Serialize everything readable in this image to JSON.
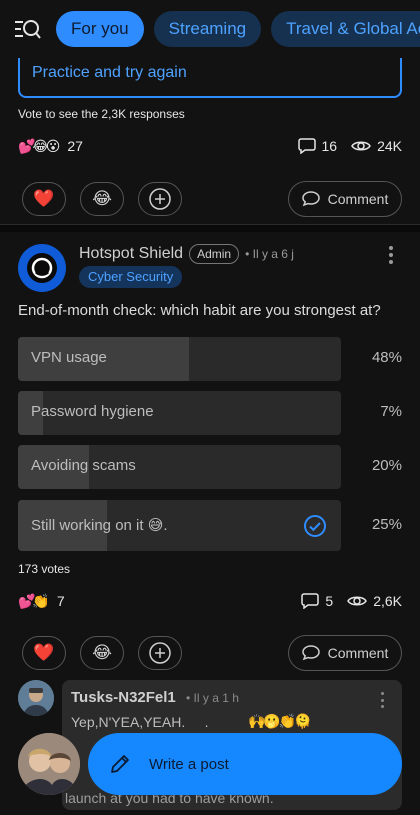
{
  "topbar": {
    "tabs": [
      {
        "label": "For you",
        "active": true
      },
      {
        "label": "Streaming",
        "active": false
      },
      {
        "label": "Travel & Global Acces",
        "active": false
      }
    ]
  },
  "prev_post": {
    "option_label": "Practice and try again",
    "vote_note": "Vote to see the 2,3K responses",
    "reaction_emojis": "💕😂😮",
    "reaction_count": "27",
    "comments": "16",
    "views": "24K",
    "comment_label": "Comment"
  },
  "post": {
    "author": "Hotspot Shield",
    "badge": "Admin",
    "time": "• Il y a 6 j",
    "tag": "Cyber Security",
    "question": "End-of-month check: which habit are you strongest at?",
    "poll": [
      {
        "label": "VPN usage",
        "percent_text": "48%",
        "fraction": 0.48,
        "selected": false
      },
      {
        "label": "Password hygiene",
        "percent_text": "7%",
        "fraction": 0.07,
        "selected": false
      },
      {
        "label": " Avoiding scams",
        "percent_text": "20%",
        "fraction": 0.2,
        "selected": false
      },
      {
        "label": "Still working on it 😅.",
        "percent_text": "25%",
        "fraction": 0.25,
        "selected": true
      }
    ],
    "votes": "173 votes",
    "reaction_emojis": "💕👏",
    "reaction_count": "7",
    "comments": "5",
    "views": "2,6K",
    "comment_label": "Comment"
  },
  "comment": {
    "author": "Tusks-N32Fel1",
    "time": "• Il y a 1 h",
    "text_line1": "Yep,N'YEA,YEAH.     .",
    "emojis": "🙌🫢👏🫠",
    "text_line2": "launch at you had to have known."
  },
  "fab": {
    "label": "Write a post"
  },
  "colors": {
    "accent": "#2f8cff",
    "background": "#121212"
  }
}
